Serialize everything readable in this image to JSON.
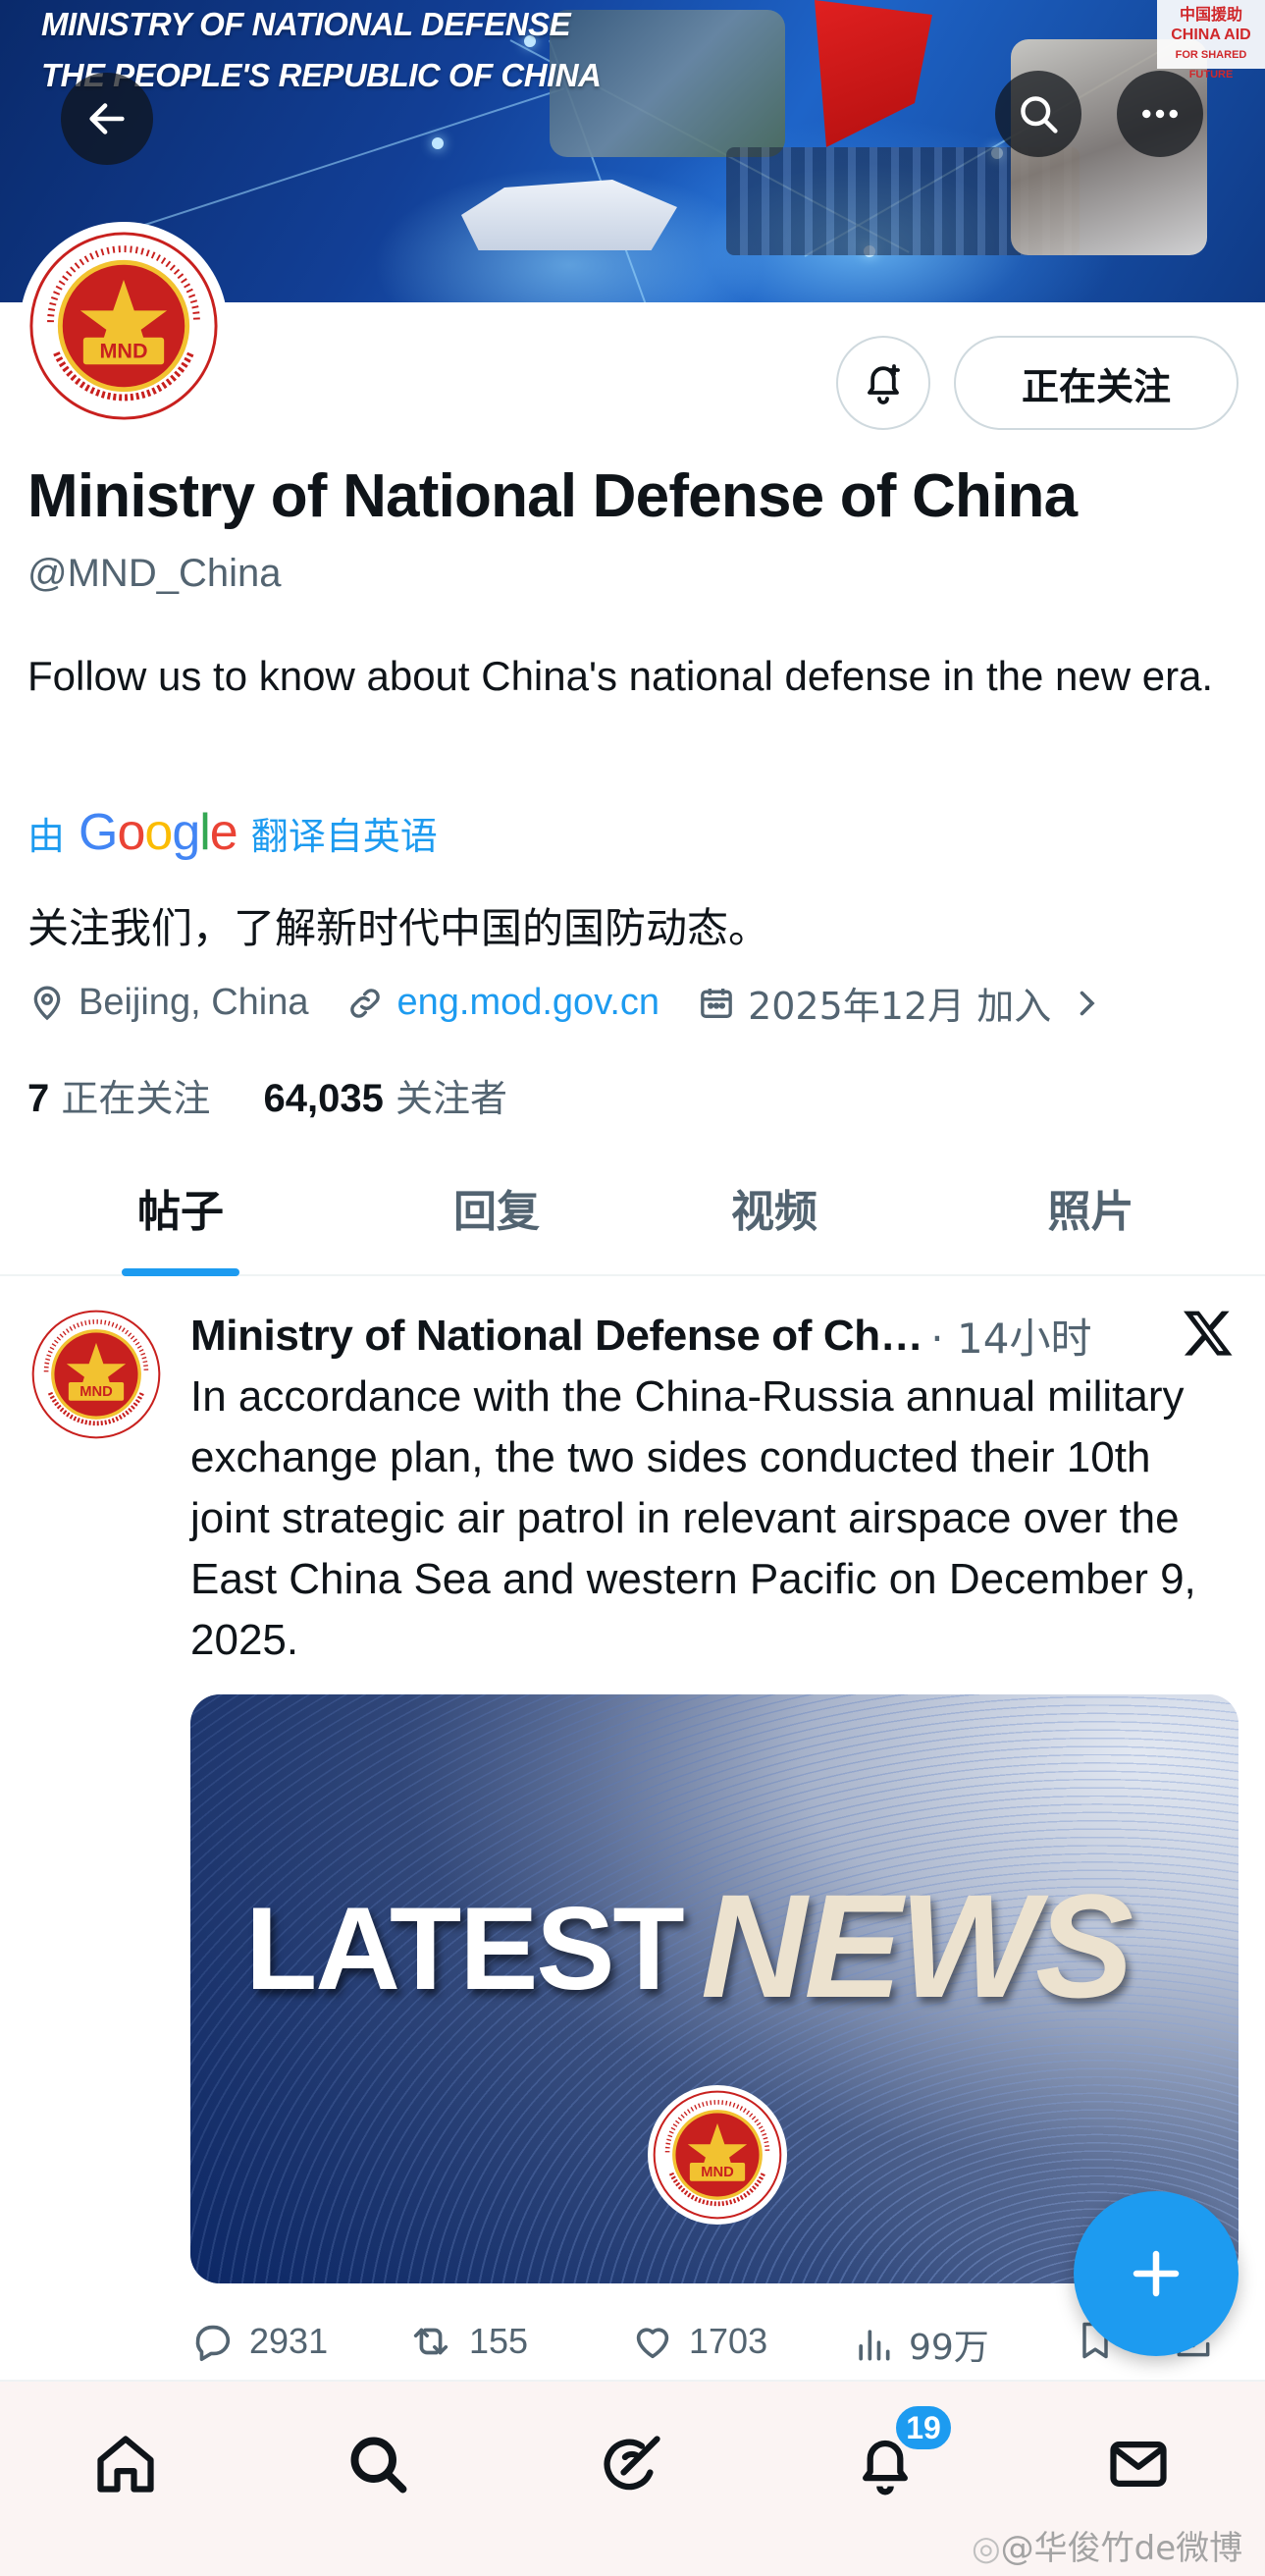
{
  "banner": {
    "title_line1": "MINISTRY OF NATIONAL DEFENSE",
    "title_line2": "THE PEOPLE'S REPUBLIC OF CHINA",
    "aid_text": "中国援助",
    "aid_en": "CHINA AID",
    "aid_small": "FOR SHARED FUTURE"
  },
  "header_icons": {
    "back": "arrow-left-icon",
    "search": "search-icon",
    "more": "more-icon"
  },
  "profile": {
    "logo_text": "MND",
    "notify_icon": "bell-plus-icon",
    "follow_button": "正在关注",
    "name": "Ministry of National Defense of China",
    "handle": "@MND_China",
    "bio": "Follow us to know about China's national defense in the new era.",
    "translated_prefix": "由",
    "translated_brand": "Google",
    "translated_suffix": "翻译自英语",
    "bio_translated": "关注我们，了解新时代中国的国防动态。",
    "location": "Beijing, China",
    "website": "eng.mod.gov.cn",
    "joined": "2025年12月 加入",
    "following_count": "7",
    "following_label": "正在关注",
    "followers_count": "64,035",
    "followers_label": "关注者"
  },
  "tabs": [
    "帖子",
    "回复",
    "视频",
    "照片"
  ],
  "active_tab": "帖子",
  "post": {
    "author": "Ministry of National Defense of Ch…",
    "time": "· 14小时",
    "text": "In accordance with the China-Russia annual military exchange plan, the two sides conducted their 10th joint strategic air patrol in relevant airspace over the East China Sea and western Pacific on December 9, 2025.",
    "media_latest": "LATEST",
    "media_news": "NEWS",
    "replies": "2931",
    "reposts": "155",
    "likes": "1703",
    "views": "99万"
  },
  "bottom_nav": {
    "items": [
      "home-icon",
      "search-icon",
      "grok-icon",
      "notifications-icon",
      "messages-icon"
    ],
    "notification_badge": "19"
  },
  "watermark": "@华俊竹de微博",
  "colors": {
    "accent": "#1d9bf0",
    "text_primary": "#0f1419",
    "text_secondary": "#536471",
    "mnd_red": "#c8201e",
    "mnd_gold": "#f2c230"
  }
}
